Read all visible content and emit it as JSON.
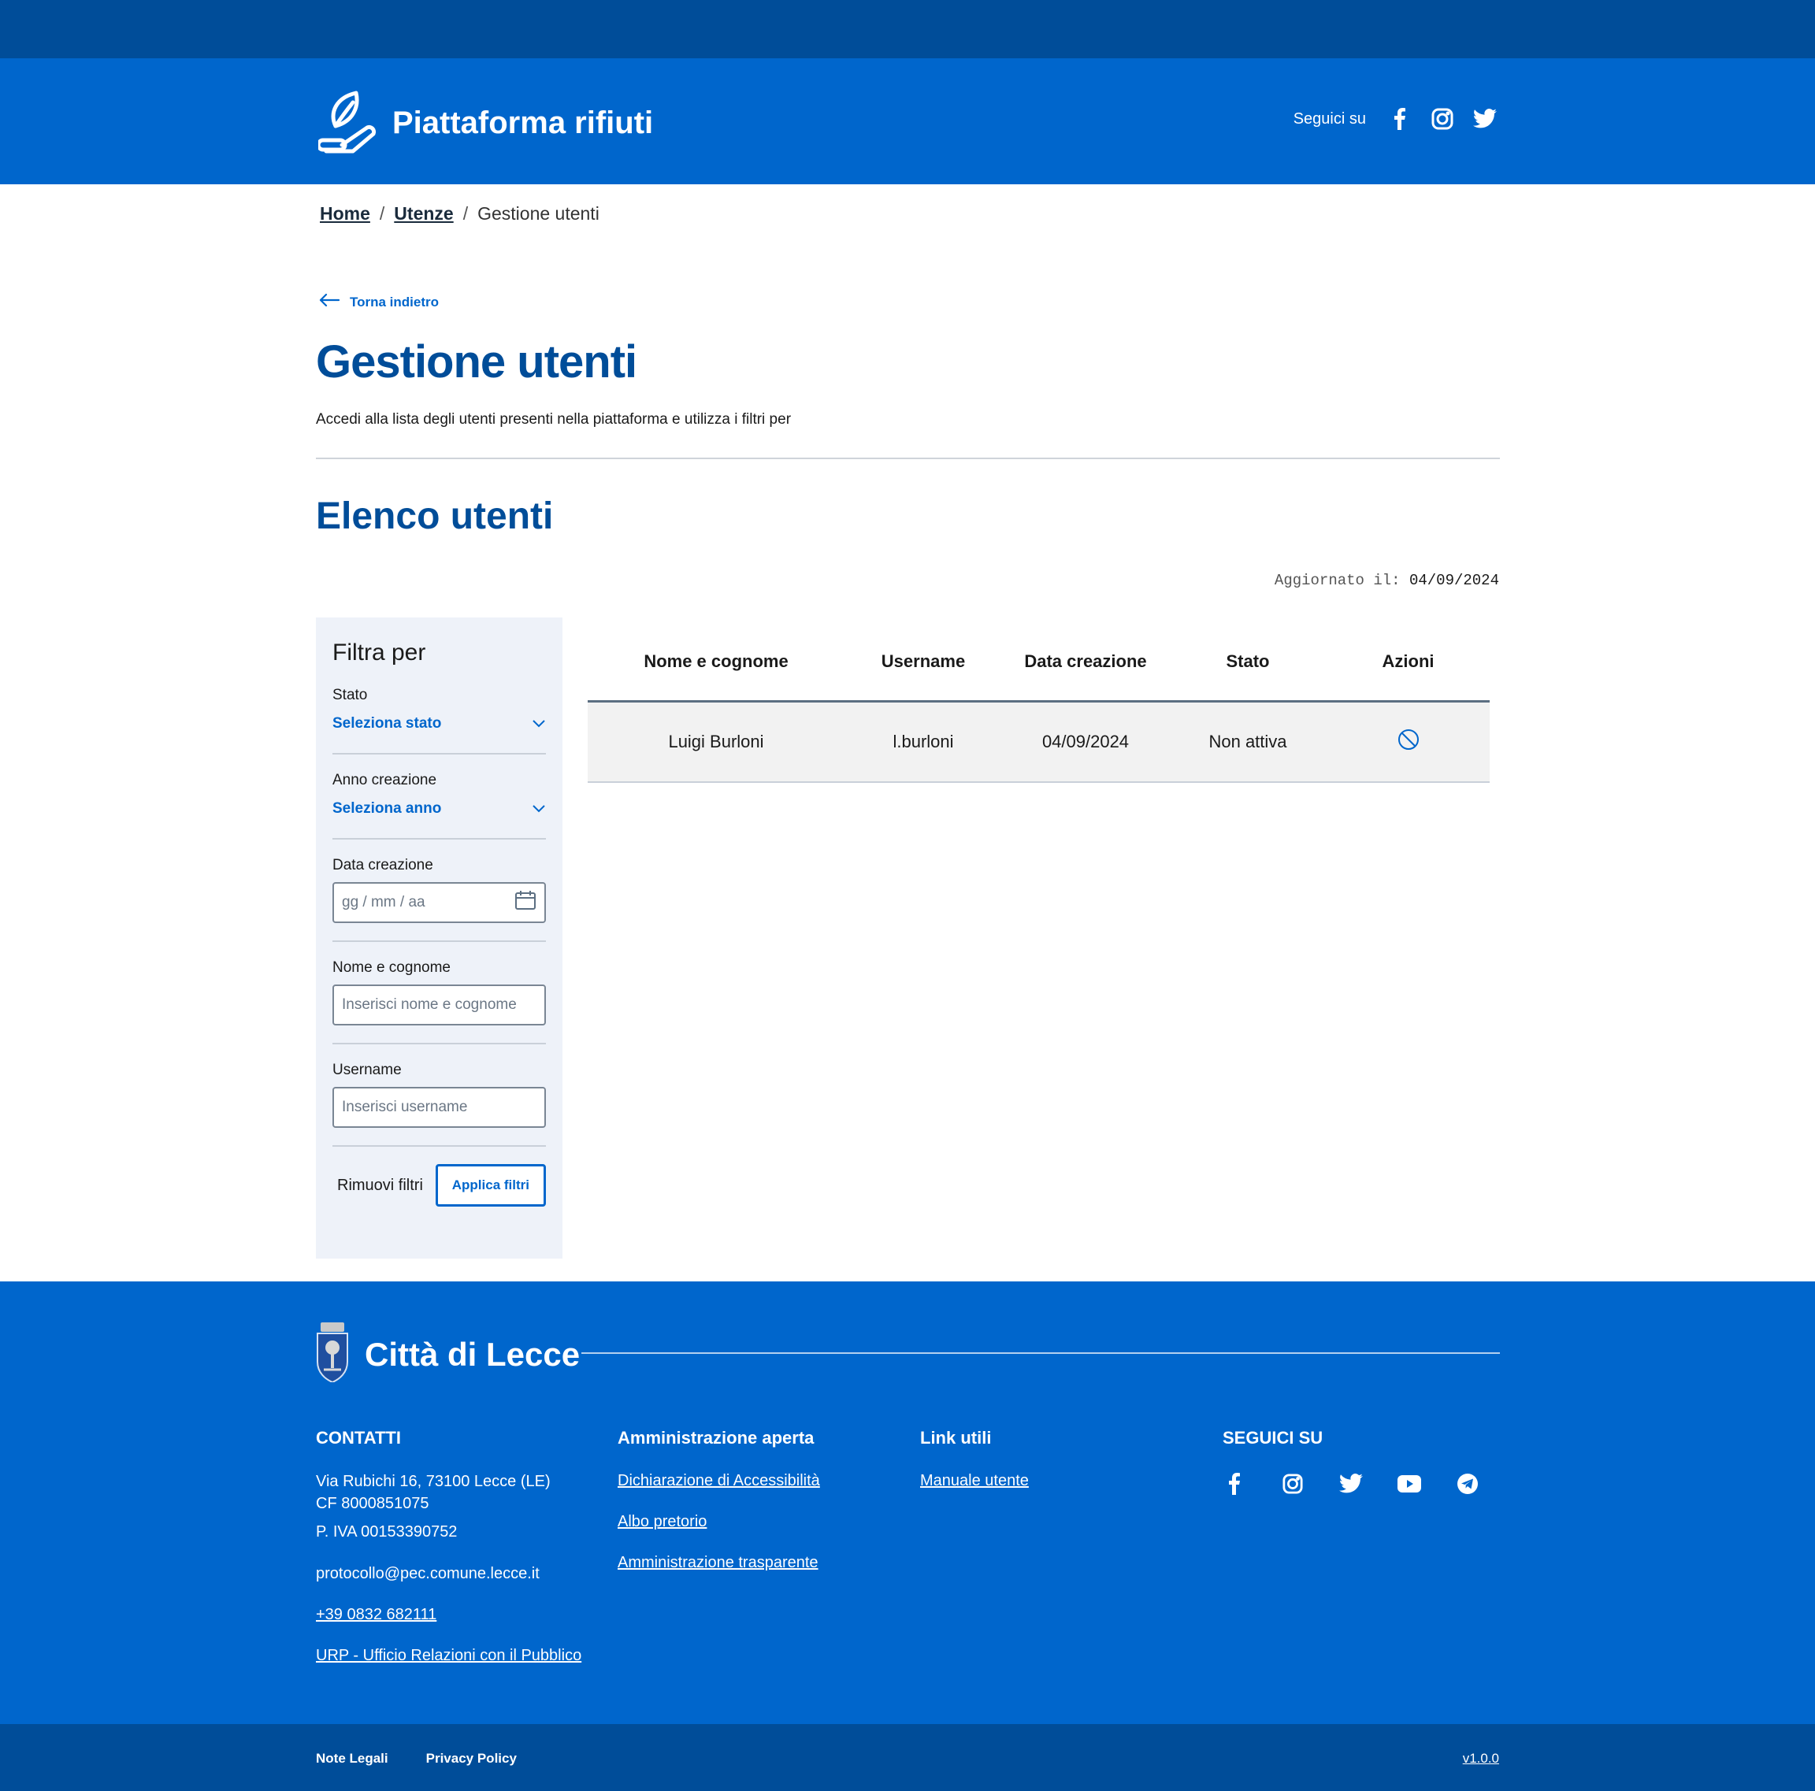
{
  "header": {
    "title": "Piattaforma rifiuti",
    "follow_label": "Seguici su",
    "social_icons": [
      "facebook-icon",
      "instagram-icon",
      "twitter-icon"
    ]
  },
  "breadcrumb": {
    "items": [
      "Home",
      "Utenze"
    ],
    "current": "Gestione utenti"
  },
  "back_label": "Torna indietro",
  "page": {
    "title": "Gestione utenti",
    "description": "Accedi alla lista degli utenti presenti nella piattaforma e utilizza i filtri per"
  },
  "section": {
    "title": "Elenco utenti",
    "updated_label": "Aggiornato il:",
    "updated_value": "04/09/2024"
  },
  "filters": {
    "title": "Filtra per",
    "stato_label": "Stato",
    "stato_value": "Seleziona stato",
    "anno_label": "Anno creazione",
    "anno_value": "Seleziona anno",
    "data_label": "Data creazione",
    "data_placeholder": "gg / mm / aa",
    "nome_label": "Nome e cognome",
    "nome_placeholder": "Inserisci nome e cognome",
    "username_label": "Username",
    "username_placeholder": "Inserisci username",
    "clear_label": "Rimuovi filtri",
    "apply_label": "Applica filtri"
  },
  "table": {
    "headers": [
      "Nome e cognome",
      "Username",
      "Data creazione",
      "Stato",
      "Azioni"
    ],
    "rows": [
      [
        "Luigi Burloni",
        "l.burloni",
        "04/09/2024",
        "Non attiva"
      ]
    ]
  },
  "footer": {
    "brand": "Città di Lecce",
    "contacts_title": "CONTATTI",
    "address": "Via Rubichi 16, 73100 Lecce (LE)",
    "cf": "CF 8000851075",
    "piva": "P. IVA 00153390752",
    "pec": "protocollo@pec.comune.lecce.it",
    "phone": "+39 0832 682111",
    "urp": "URP - Ufficio Relazioni con il Pubblico",
    "admin_title": "Amministrazione aperta",
    "admin_links": [
      "Dichiarazione di Accessibilità",
      "Albo pretorio",
      "Amministrazione trasparente"
    ],
    "useful_title": "Link utili",
    "useful_links": [
      "Manuale utente"
    ],
    "social_title": "SEGUICI SU",
    "social_icons": [
      "facebook-icon",
      "instagram-icon",
      "twitter-icon",
      "youtube-icon",
      "telegram-icon"
    ]
  },
  "bottom": {
    "legal": "Note Legali",
    "privacy": "Privacy Policy",
    "version": "v1.0.0"
  },
  "colors": {
    "primary": "#0066cc",
    "dark": "#004d99"
  }
}
